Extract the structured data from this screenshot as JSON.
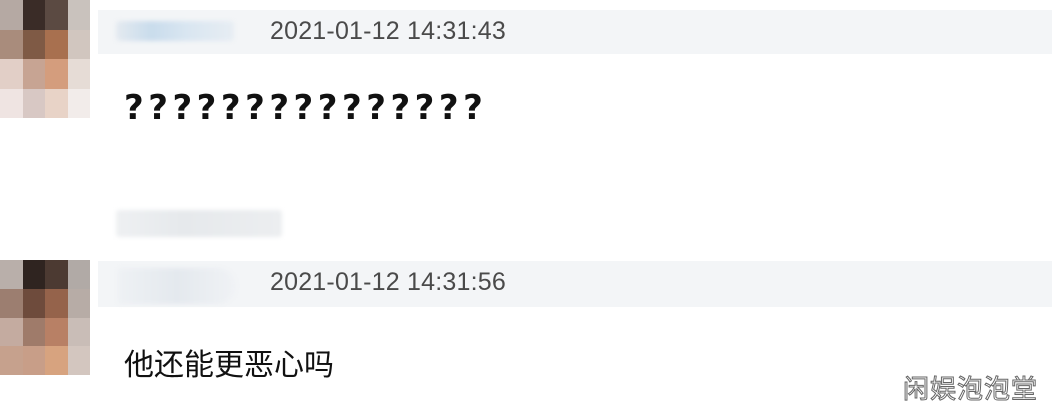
{
  "comments": [
    {
      "timestamp": "2021-01-12 14:31:43",
      "text": "???????????????",
      "avatar_colors": [
        "#b5a9a3",
        "#3a2c27",
        "#5b4a42",
        "#c9c2bd",
        "#a98c7c",
        "#7f5a45",
        "#a8704f",
        "#d1c6bf",
        "#e2cfc7",
        "#c7a493",
        "#d49d7d",
        "#e6dcd6",
        "#efe4e2",
        "#d8c8c4",
        "#e8d3c7",
        "#f2ecea"
      ]
    },
    {
      "timestamp": "2021-01-12 14:31:56",
      "text": "他还能更恶心吗",
      "avatar_colors": [
        "#b9afaa",
        "#2f2420",
        "#4c3a32",
        "#b1aaa6",
        "#9c7e70",
        "#6e4b3c",
        "#95634b",
        "#b7aca6",
        "#c4aba0",
        "#9f7b6a",
        "#b88065",
        "#c9bdb7",
        "#c6a18d",
        "#c89e88",
        "#d7a37f",
        "#d3c6bf"
      ]
    }
  ],
  "watermark": "闲娱泡泡堂"
}
